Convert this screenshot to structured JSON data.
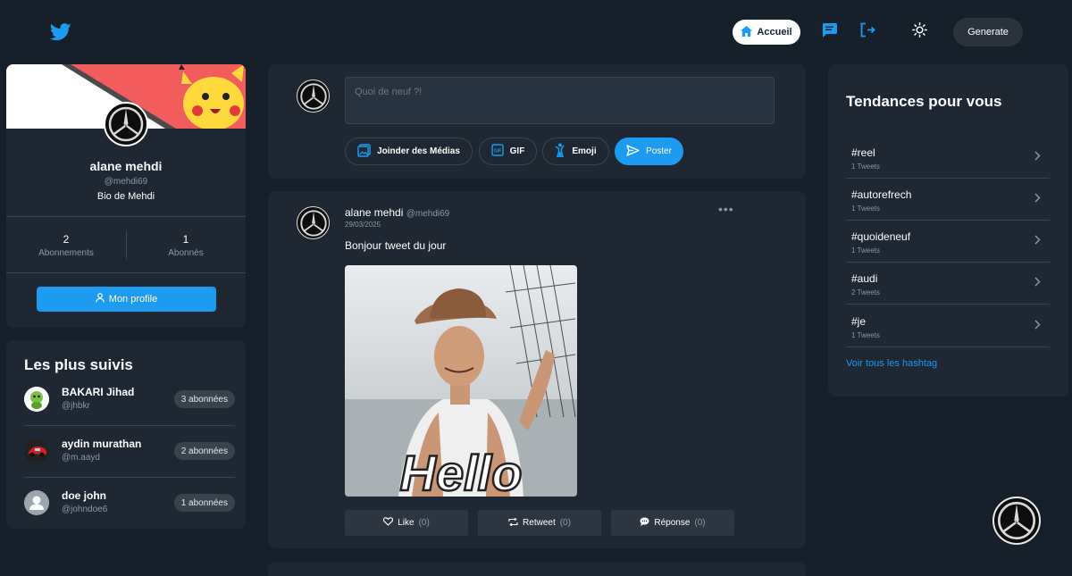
{
  "nav": {
    "home_label": "Accueil",
    "generate_label": "Generate"
  },
  "profile": {
    "name": "alane mehdi",
    "handle": "@mehdi69",
    "bio": "Bio de Mehdi",
    "following_count": "2",
    "following_label": "Abonnements",
    "followers_count": "1",
    "followers_label": "Abonnés",
    "button_label": "Mon profile"
  },
  "most_followed": {
    "title": "Les plus suivis",
    "users": [
      {
        "name": "BAKARI Jihad",
        "handle": "@jhbkr",
        "followers": "3 abonnées"
      },
      {
        "name": "aydin murathan",
        "handle": "@m.aayd",
        "followers": "2 abonnées"
      },
      {
        "name": "doe john",
        "handle": "@johndoe6",
        "followers": "1 abonnées"
      }
    ]
  },
  "composer": {
    "placeholder": "Quoi de neuf ?!",
    "media_label": "Joinder des Médias",
    "gif_label": "GIF",
    "emoji_label": "Emoji",
    "post_label": "Poster"
  },
  "tweet": {
    "author": "alane mehdi",
    "handle": "@mehdi69",
    "date": "29/03/2025",
    "text": "Bonjour tweet du jour",
    "media_caption": "Hello",
    "like_label": "Like",
    "like_count": "(0)",
    "retweet_label": "Retweet",
    "retweet_count": "(0)",
    "reply_label": "Réponse",
    "reply_count": "(0)"
  },
  "trends": {
    "title": "Tendances pour vous",
    "items": [
      {
        "tag": "#reel",
        "count": "1 Tweets"
      },
      {
        "tag": "#autorefrech",
        "count": "1 Tweets"
      },
      {
        "tag": "#quoideneuf",
        "count": "1 Tweets"
      },
      {
        "tag": "#audi",
        "count": "2 Tweets"
      },
      {
        "tag": "#je",
        "count": "1 Tweets"
      }
    ],
    "see_all_label": "Voir tous les hashtag"
  },
  "colors": {
    "background": "#15202b",
    "card": "#1e2732",
    "accent": "#1d9bf0",
    "muted_text": "#8899a6",
    "border": "#38444d"
  },
  "icons": [
    "twitter-bird-icon",
    "home-icon",
    "message-icon",
    "logout-icon",
    "sun-icon",
    "user-icon",
    "image-icon",
    "gif-icon",
    "emoji-person-icon",
    "send-icon",
    "heart-icon",
    "retweet-icon",
    "comment-icon",
    "chevron-right-icon",
    "more-dots-icon"
  ]
}
